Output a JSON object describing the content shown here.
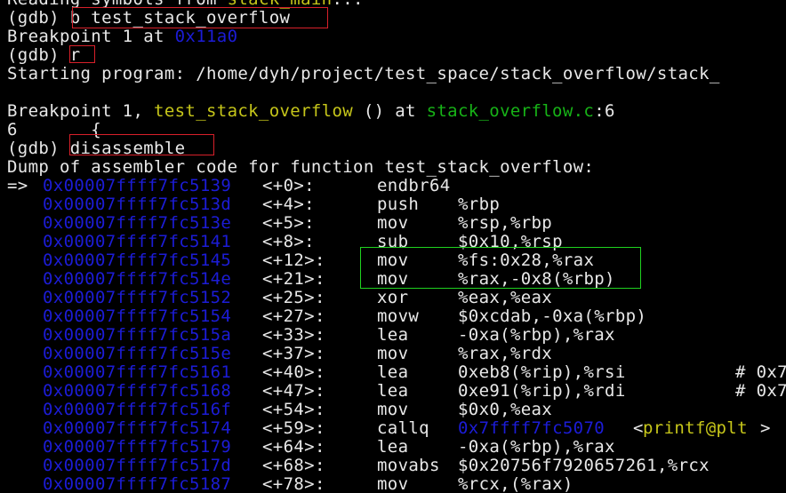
{
  "terminal": {
    "lines": [
      {
        "segments": [
          {
            "text": "Reading symbols from ",
            "color": "default"
          },
          {
            "text": "stack_main",
            "color": "yellow"
          },
          {
            "text": "...",
            "color": "default"
          }
        ]
      },
      {
        "segments": [
          {
            "text": "(gdb) ",
            "color": "default"
          },
          {
            "text": "b test_stack_overflow",
            "color": "default"
          }
        ]
      },
      {
        "segments": [
          {
            "text": "Breakpoint 1 at ",
            "color": "default"
          },
          {
            "text": "0x11a0",
            "color": "blue"
          }
        ]
      },
      {
        "segments": [
          {
            "text": "(gdb) ",
            "color": "default"
          },
          {
            "text": "r",
            "color": "default"
          }
        ]
      },
      {
        "segments": [
          {
            "text": "Starting program: /home/dyh/project/test_space/stack_overflow/stack_",
            "color": "default"
          }
        ]
      },
      {
        "segments": []
      },
      {
        "segments": [
          {
            "text": "Breakpoint 1, ",
            "color": "default"
          },
          {
            "text": "test_stack_overflow",
            "color": "yellow"
          },
          {
            "text": " () at ",
            "color": "default"
          },
          {
            "text": "stack_overflow.c",
            "color": "green"
          },
          {
            "text": ":6",
            "color": "default"
          }
        ]
      },
      {
        "segments": [
          {
            "text": "6       {",
            "color": "default"
          }
        ]
      },
      {
        "segments": [
          {
            "text": "(gdb) ",
            "color": "default"
          },
          {
            "text": "disassemble",
            "color": "default"
          }
        ]
      },
      {
        "segments": [
          {
            "text": "Dump of assembler code for function test_stack_overflow:",
            "color": "default"
          }
        ]
      }
    ],
    "asm": [
      {
        "marker": "=>",
        "addr": "0x00007ffff7fc5139",
        "off": "<+0>:",
        "mnem": "endbr64",
        "ops": "",
        "comment": ""
      },
      {
        "marker": "",
        "addr": "0x00007ffff7fc513d",
        "off": "<+4>:",
        "mnem": "push",
        "ops": "%rbp",
        "comment": ""
      },
      {
        "marker": "",
        "addr": "0x00007ffff7fc513e",
        "off": "<+5>:",
        "mnem": "mov",
        "ops": "%rsp,%rbp",
        "comment": ""
      },
      {
        "marker": "",
        "addr": "0x00007ffff7fc5141",
        "off": "<+8>:",
        "mnem": "sub",
        "ops": "$0x10,%rsp",
        "comment": ""
      },
      {
        "marker": "",
        "addr": "0x00007ffff7fc5145",
        "off": "<+12>:",
        "mnem": "mov",
        "ops": "%fs:0x28,%rax",
        "comment": ""
      },
      {
        "marker": "",
        "addr": "0x00007ffff7fc514e",
        "off": "<+21>:",
        "mnem": "mov",
        "ops": "%rax,-0x8(%rbp)",
        "comment": ""
      },
      {
        "marker": "",
        "addr": "0x00007ffff7fc5152",
        "off": "<+25>:",
        "mnem": "xor",
        "ops": "%eax,%eax",
        "comment": ""
      },
      {
        "marker": "",
        "addr": "0x00007ffff7fc5154",
        "off": "<+27>:",
        "mnem": "movw",
        "ops": "$0xcdab,-0xa(%rbp)",
        "comment": ""
      },
      {
        "marker": "",
        "addr": "0x00007ffff7fc515a",
        "off": "<+33>:",
        "mnem": "lea",
        "ops": "-0xa(%rbp),%rax",
        "comment": ""
      },
      {
        "marker": "",
        "addr": "0x00007ffff7fc515e",
        "off": "<+37>:",
        "mnem": "mov",
        "ops": "%rax,%rdx",
        "comment": ""
      },
      {
        "marker": "",
        "addr": "0x00007ffff7fc5161",
        "off": "<+40>:",
        "mnem": "lea",
        "ops": "0xeb8(%rip),%rsi",
        "comment": "# 0x7"
      },
      {
        "marker": "",
        "addr": "0x00007ffff7fc5168",
        "off": "<+47>:",
        "mnem": "lea",
        "ops": "0xe91(%rip),%rdi",
        "comment": "# 0x7"
      },
      {
        "marker": "",
        "addr": "0x00007ffff7fc516f",
        "off": "<+54>:",
        "mnem": "mov",
        "ops": "$0x0,%eax",
        "comment": ""
      },
      {
        "marker": "",
        "addr": "0x00007ffff7fc5174",
        "off": "<+59>:",
        "mnem": "callq",
        "ops": "",
        "call_addr": "0x7ffff7fc5070",
        "call_sym": "printf@plt",
        "comment": ""
      },
      {
        "marker": "",
        "addr": "0x00007ffff7fc5179",
        "off": "<+64>:",
        "mnem": "lea",
        "ops": "-0xa(%rbp),%rax",
        "comment": ""
      },
      {
        "marker": "",
        "addr": "0x00007ffff7fc517d",
        "off": "<+68>:",
        "mnem": "movabs",
        "ops": "$0x20756f792065726 1,%rcx",
        "comment": ""
      },
      {
        "marker": "",
        "addr": "0x00007ffff7fc5187",
        "off": "<+78>:",
        "mnem": "mov",
        "ops": "%rcx,(%rax)",
        "comment": ""
      }
    ]
  },
  "colors": {
    "default": "#e8e8e8",
    "blue": "#1c1cd6",
    "yellow": "#c6c61a",
    "green": "#17b317",
    "highlight_red": "#d8202a",
    "highlight_green": "#1fd21f"
  }
}
